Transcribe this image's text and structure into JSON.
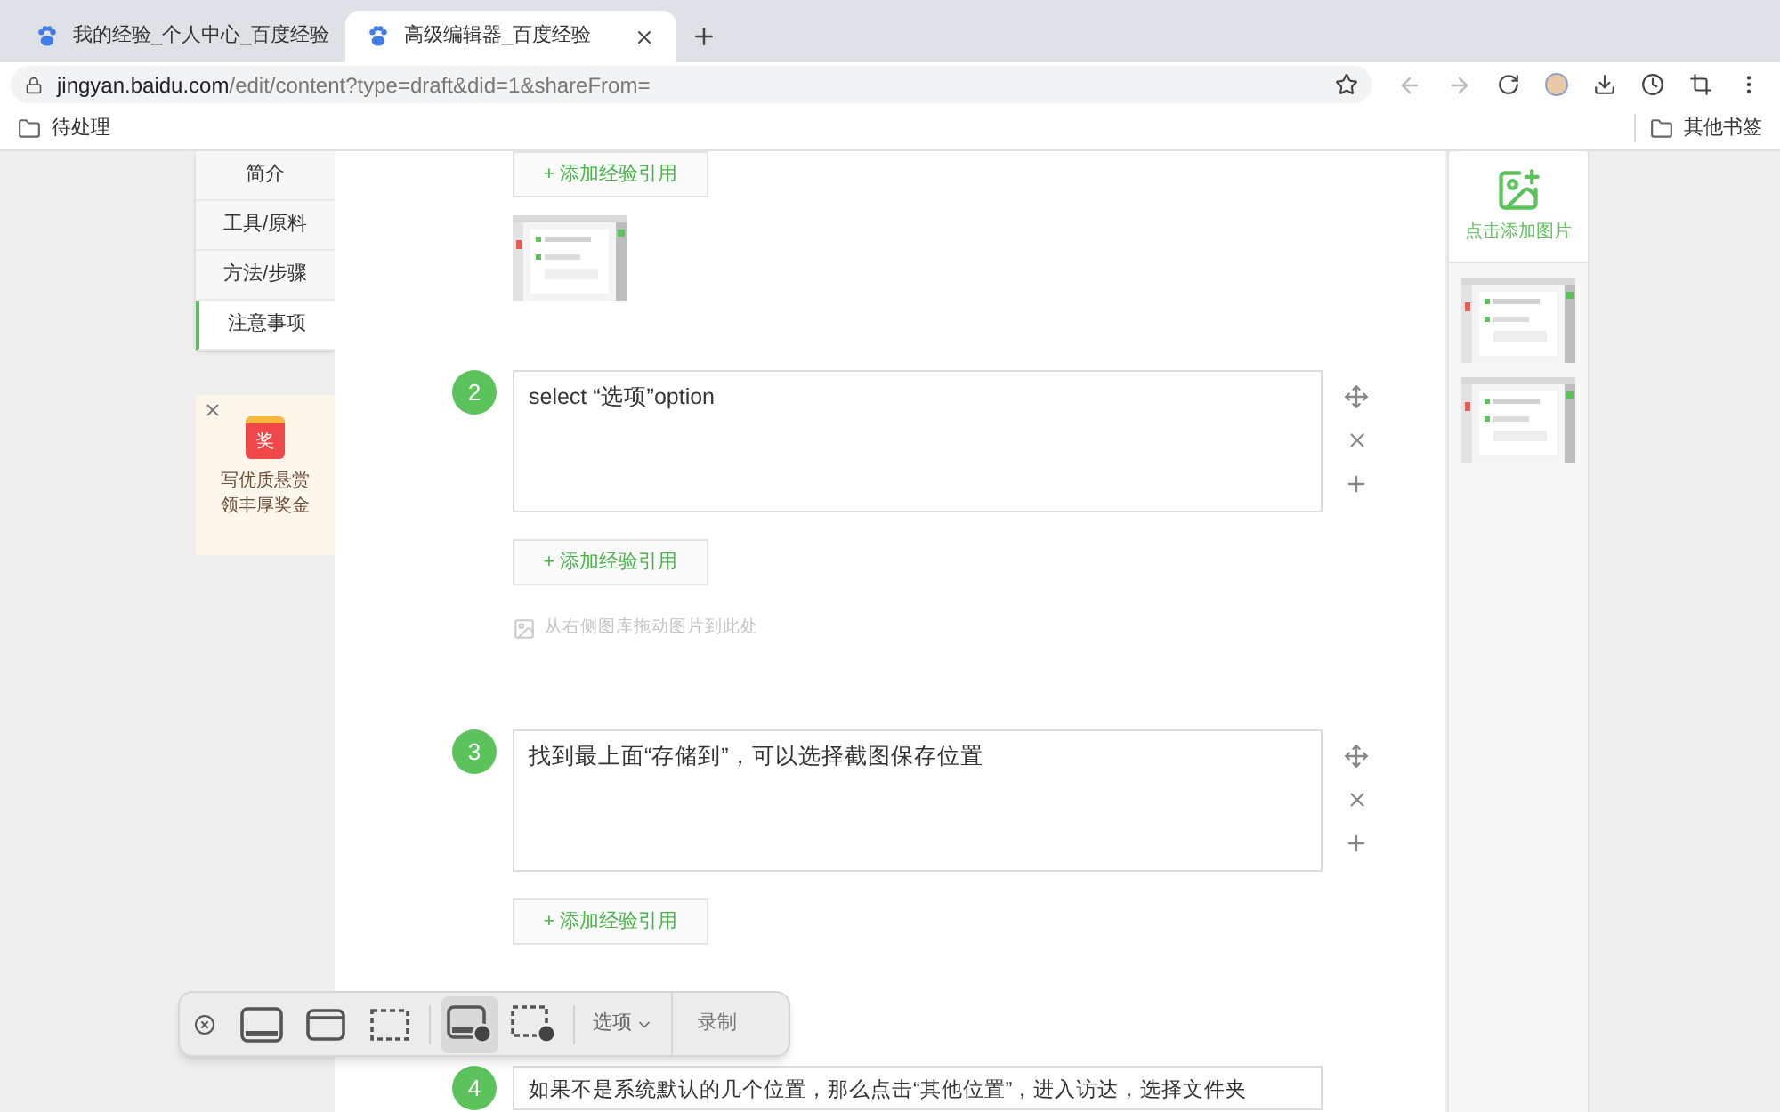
{
  "browser": {
    "tabs": [
      {
        "title": "我的经验_个人中心_百度经验",
        "selected": false
      },
      {
        "title": "高级编辑器_百度经验",
        "selected": true
      }
    ],
    "url": {
      "host": "jingyan.baidu.com",
      "path": "/edit/content?type=draft&did=1&shareFrom="
    },
    "bookmarks": [
      "待处理"
    ],
    "other_bookmarks": "其他书签"
  },
  "left_nav": {
    "items": [
      {
        "label": "简介",
        "selected": false
      },
      {
        "label": "工具/原料",
        "selected": false
      },
      {
        "label": "方法/步骤",
        "selected": false
      },
      {
        "label": "注意事项",
        "selected": true
      }
    ],
    "promo": {
      "badge": "奖",
      "lines": [
        "写优质悬赏",
        "领丰厚奖金"
      ]
    }
  },
  "editor": {
    "top_ref_button": "+ 添加经验引用",
    "steps": [
      {
        "number": "2",
        "text": "select “选项”option",
        "ref_button": "+ 添加经验引用",
        "drop_hint": "从右侧图库拖动图片到此处"
      },
      {
        "number": "3",
        "text": "找到最上面“存储到”，可以选择截图保存位置",
        "ref_button": "+ 添加经验引用"
      },
      {
        "number": "4",
        "text": "如果不是系统默认的几个位置，那么点击“其他位置”，进入访达，选择文件夹"
      }
    ]
  },
  "image_panel": {
    "add_label": "点击添加图片"
  },
  "capture_toolbar": {
    "tools": [
      {
        "kind": "screen",
        "selected": false
      },
      {
        "kind": "window",
        "selected": false
      },
      {
        "kind": "selection",
        "selected": false
      },
      {
        "kind": "record-screen",
        "selected": true
      },
      {
        "kind": "record-selection",
        "selected": false
      }
    ],
    "options": "选项",
    "record": "录制"
  }
}
